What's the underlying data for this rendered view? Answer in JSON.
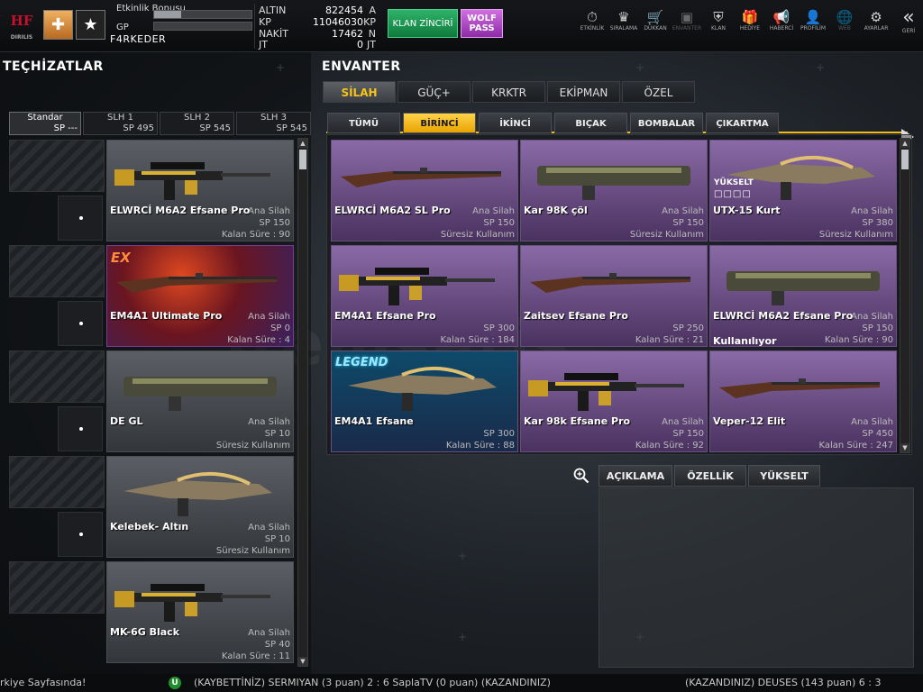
{
  "player": {
    "event_bonus_label": "Etkinlik Bonusu",
    "gp_label": "GP",
    "name": "F4RKEDER",
    "event_bonus_fill": 0.28,
    "gp_fill": 0.0
  },
  "logo_text": "HF",
  "logo_sub": "DIRILIS",
  "currency": [
    {
      "key": "ALTIN",
      "value": "822454",
      "unit": "A"
    },
    {
      "key": "KP",
      "value": "11046030",
      "unit": "KP"
    },
    {
      "key": "NAKİT",
      "value": "17462",
      "unit": "N"
    },
    {
      "key": "JT",
      "value": "0",
      "unit": "JT"
    }
  ],
  "promo": {
    "klan": "KLAN ZİNCİRİ",
    "wolf": "WOLF PASS"
  },
  "nav": [
    {
      "label": "ETKİNLİK",
      "icon": "⏱",
      "name": "nav-etkinlik"
    },
    {
      "label": "SIRALAMA",
      "icon": "♛",
      "name": "nav-siralama"
    },
    {
      "label": "DÜKKAN",
      "icon": "🛒",
      "name": "nav-dukkan"
    },
    {
      "label": "ENVANTER",
      "icon": "▣",
      "name": "nav-envanter"
    },
    {
      "label": "KLAN",
      "icon": "⛨",
      "name": "nav-klan"
    },
    {
      "label": "HEDİYE",
      "icon": "🎁",
      "name": "nav-hediye"
    },
    {
      "label": "HABERCİ",
      "icon": "📢",
      "name": "nav-haberci"
    },
    {
      "label": "PROFİLİM",
      "icon": "👤",
      "name": "nav-profilim"
    },
    {
      "label": "WEB",
      "icon": "🌐",
      "name": "nav-web"
    },
    {
      "label": "AYARLAR",
      "icon": "⚙",
      "name": "nav-ayarlar"
    }
  ],
  "back": {
    "label": "GERİ",
    "icon": "«"
  },
  "left": {
    "title": "TEÇHİZATLAR",
    "tabs": [
      {
        "name": "Standar",
        "sp": "SP ---"
      },
      {
        "name": "SLH 1",
        "sp": "SP 495"
      },
      {
        "name": "SLH 2",
        "sp": "SP 545"
      },
      {
        "name": "SLH 3",
        "sp": "SP 545"
      }
    ],
    "items": [
      {
        "name": "ELWRCİ M6A2 Efsane Pro",
        "type": "Ana Silah",
        "sp": "SP 150",
        "time": "Kalan Süre : 90"
      },
      {
        "name": "EM4A1 Ultimate Pro",
        "type": "Ana Silah",
        "sp": "SP 0",
        "time": "Kalan Süre : 4",
        "badge": "EX"
      },
      {
        "name": "DE GL",
        "type": "Ana Silah",
        "sp": "SP 10",
        "time": "Süresiz Kullanım"
      },
      {
        "name": "Kelebek- Altın",
        "type": "Ana Silah",
        "sp": "SP 10",
        "time": "Süresiz Kullanım"
      },
      {
        "name": "MK-6G Black",
        "type": "Ana Silah",
        "sp": "SP 40",
        "time": "Kalan Süre : 11"
      }
    ]
  },
  "right": {
    "title": "ENVANTER",
    "tabs": [
      "SİLAH",
      "GÜÇ+",
      "KRKTR",
      "EKİPMAN",
      "ÖZEL"
    ],
    "subtabs": [
      "TÜMÜ",
      "BİRİNCİ",
      "İKİNCİ",
      "BIÇAK",
      "BOMBALAR",
      "ÇIKARTMA"
    ],
    "items": [
      {
        "name": "ELWRCİ M6A2 SL Pro",
        "type": "Ana Silah",
        "sp": "SP 150",
        "time": "Süresiz Kullanım"
      },
      {
        "name": "Kar 98K çöl",
        "type": "Ana Silah",
        "sp": "SP 150",
        "time": "Süresiz Kullanım"
      },
      {
        "name": "UTX-15 Kurt",
        "type": "Ana Silah",
        "sp": "SP 380",
        "time": "Süresiz Kullanım",
        "upgrade": "YÜKSELT",
        "upgrade_boxes": "□□□□"
      },
      {
        "name": "EM4A1 Efsane Pro",
        "type": "",
        "sp": "SP 300",
        "time": "Kalan Süre : 184"
      },
      {
        "name": "Zaitsev Efsane Pro",
        "type": "",
        "sp": "SP 250",
        "time": "Kalan Süre : 21"
      },
      {
        "name": "ELWRCİ M6A2 Efsane Pro",
        "type": "Ana Silah",
        "sp": "SP 150",
        "time": "Kalan Süre : 90",
        "status": "Kullanılıyor"
      },
      {
        "name": "EM4A1 Efsane",
        "type": "",
        "sp": "SP 300",
        "time": "Kalan Süre : 88",
        "badge": "LEGEND"
      },
      {
        "name": "Kar 98k Efsane Pro",
        "type": "Ana Silah",
        "sp": "SP 150",
        "time": "Kalan Süre : 92"
      },
      {
        "name": "Veper-12 Elit",
        "type": "Ana Silah",
        "sp": "SP 450",
        "time": "Kalan Süre : 247"
      }
    ],
    "detail_tabs": [
      "AÇIKLAMA",
      "ÖZELLİK",
      "YÜKSELT"
    ]
  },
  "watermark": "itemsatis",
  "ticker": {
    "left": "rkiye Sayfasında!",
    "icon": "U",
    "msg1": "(KAYBETTİNİZ) SERMIYAN (3 puan) 2 : 6 SaplaTV (0 puan) (KAZANDINIZ)",
    "msg2": "(KAZANDINIZ) DEUSES (143 puan) 6 : 3"
  },
  "colors": {
    "accent": "#f3b81a",
    "inventory_cell": "#8a6aa6",
    "klan_green": "#1f9a52",
    "wolf_purple": "#b04cc8"
  }
}
